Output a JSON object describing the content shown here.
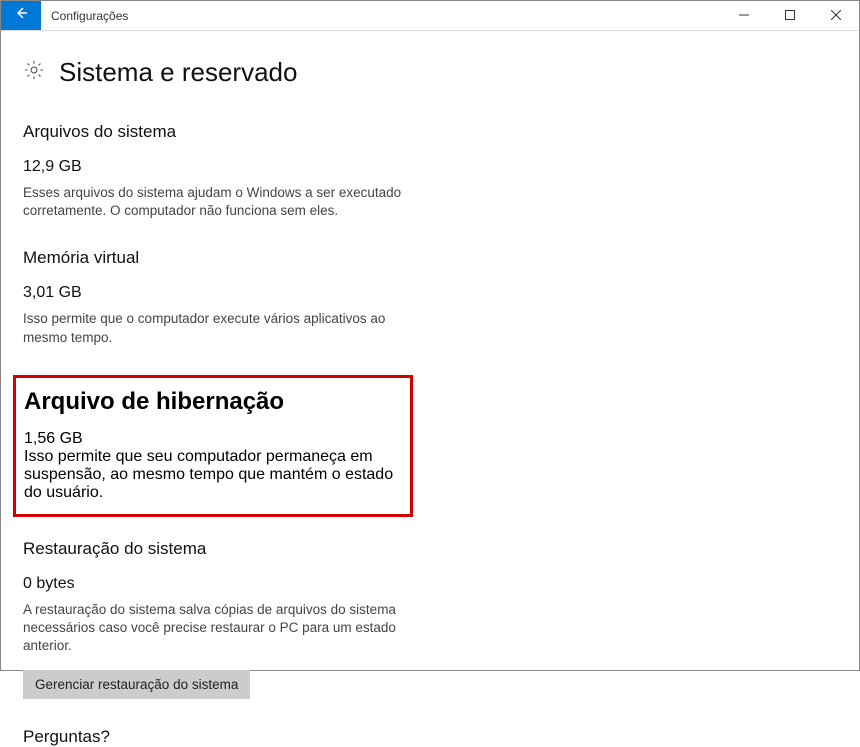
{
  "titlebar": {
    "title": "Configurações"
  },
  "page": {
    "heading": "Sistema e reservado"
  },
  "sections": {
    "system_files": {
      "title": "Arquivos do sistema",
      "size": "12,9 GB",
      "desc": "Esses arquivos do sistema ajudam o Windows a ser executado corretamente. O computador não funciona sem eles."
    },
    "virtual_memory": {
      "title": "Memória virtual",
      "size": "3,01 GB",
      "desc": "Isso permite que o computador execute vários aplicativos ao mesmo tempo."
    },
    "hibernation": {
      "title": "Arquivo de hibernação",
      "size": "1,56 GB",
      "desc": "Isso permite que seu computador permaneça em suspensão, ao mesmo tempo que mantém o estado do usuário."
    },
    "system_restore": {
      "title": "Restauração do sistema",
      "size": "0 bytes",
      "desc": "A restauração do sistema salva cópias de arquivos do sistema necessários caso você precise restaurar o PC para um estado anterior.",
      "button": "Gerenciar restauração do sistema"
    }
  },
  "footer": {
    "questions": "Perguntas?"
  }
}
